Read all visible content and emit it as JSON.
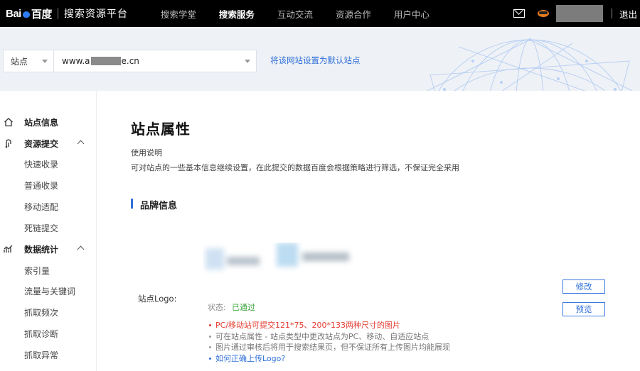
{
  "header": {
    "brand_prefix": "Bai",
    "brand_suffix": "百度",
    "title": "搜索资源平台",
    "nav": [
      {
        "label": "搜索学堂",
        "active": false
      },
      {
        "label": "搜索服务",
        "active": true
      },
      {
        "label": "互动交流",
        "active": false
      },
      {
        "label": "资源合作",
        "active": false
      },
      {
        "label": "用户中心",
        "active": false
      }
    ],
    "logout": "退出",
    "icons": [
      "mail-icon",
      "user-avatar-icon"
    ]
  },
  "site_bar": {
    "selector_label": "站点",
    "site_prefix": "www.a",
    "site_suffix": "e.cn",
    "set_default_link": "将该网站设置为默认站点"
  },
  "sidebar": {
    "groups": [
      {
        "label": "站点信息",
        "icon": "home-icon",
        "items": []
      },
      {
        "label": "资源提交",
        "icon": "submit-icon",
        "items": [
          "快速收录",
          "普通收录",
          "移动适配",
          "死链提交"
        ]
      },
      {
        "label": "数据统计",
        "icon": "stats-icon",
        "items": [
          "索引量",
          "流量与关键词",
          "抓取频次",
          "抓取诊断",
          "抓取异常"
        ]
      }
    ]
  },
  "main": {
    "title": "站点属性",
    "usage_title": "使用说明",
    "usage_desc": "可对站点的一些基本信息继续设置，在此提交的数据百度会根据策略进行筛选，不保证完全采用",
    "section_title": "品牌信息",
    "logo_label": "站点Logo:",
    "status_label": "状态:",
    "status_value": "已通过",
    "edit_button": "修改",
    "preview_button": "预览",
    "notes": [
      "PC/移动站可提交121*75、200*133两种尺寸的图片",
      "可在站点属性 - 站点类型中更改站点为PC、移动、自适应站点",
      "图片通过审核后将用于搜索结果页，但不保证所有上传图片均能展现",
      "如何正确上传Logo?"
    ]
  },
  "colors": {
    "accent": "#2f6fd8",
    "status_ok": "#3aa33a",
    "warning": "#e33a2e",
    "topbar": "#000000"
  }
}
